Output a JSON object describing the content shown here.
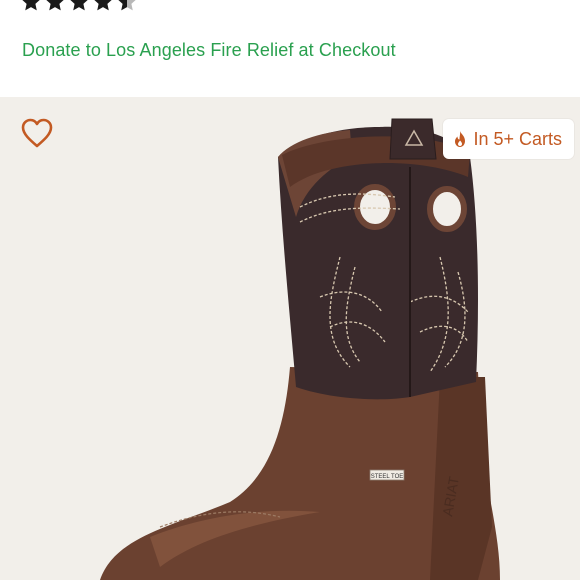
{
  "rating": {
    "stars_filled": 4,
    "stars_total": 5,
    "star_color": "#1a1a1a"
  },
  "promo": {
    "donate_text": "Donate to Los Angeles Fire Relief at Checkout",
    "color": "#2aa04f"
  },
  "product_image": {
    "like_icon": "heart-outline-icon",
    "badge_icon": "flame-icon",
    "badge_text": "In 5+ Carts",
    "badge_color": "#c35a23",
    "background": "#f2efea",
    "boot_label": "STEEL TOE",
    "brand_text": "ARIAT"
  }
}
